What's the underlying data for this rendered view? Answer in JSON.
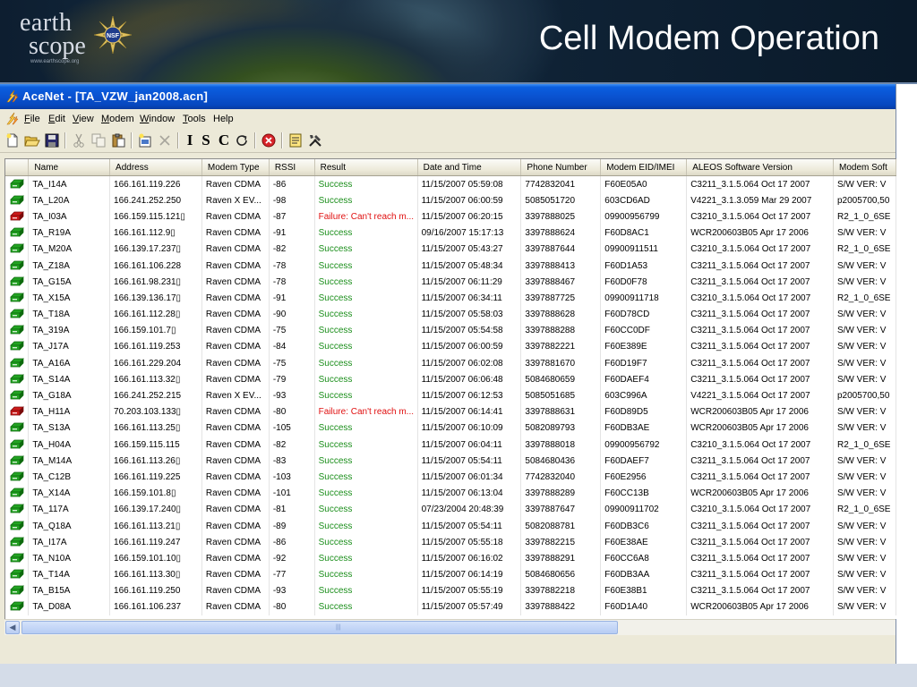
{
  "slide": {
    "title": "Cell Modem Operation",
    "logo_line1": "earth",
    "logo_line2": "scope",
    "logo_url": "www.earthscope.org",
    "nsf_label": "NSF"
  },
  "window": {
    "title": "AceNet - [TA_VZW_jan2008.acn]"
  },
  "menu": [
    {
      "label": "File",
      "key": "F",
      "rest": "ile"
    },
    {
      "label": "Edit",
      "key": "E",
      "rest": "dit"
    },
    {
      "label": "View",
      "key": "V",
      "rest": "iew"
    },
    {
      "label": "Modem",
      "key": "M",
      "rest": "odem"
    },
    {
      "label": "Window",
      "key": "W",
      "rest": "indow"
    },
    {
      "label": "Tools",
      "key": "T",
      "rest": "ools"
    },
    {
      "label": "Help",
      "key": "",
      "rest": "Help"
    }
  ],
  "toolbar": {
    "letters": [
      "I",
      "S",
      "C"
    ]
  },
  "columns": [
    "",
    "Name",
    "Address",
    "Modem Type",
    "RSSI",
    "Result",
    "Date and Time",
    "Phone Number",
    "Modem EID/IMEI",
    "ALEOS Software Version",
    "Modem Soft"
  ],
  "rows": [
    {
      "status": "ok",
      "name": "TA_I14A",
      "address": "166.161.119.226",
      "type": "Raven CDMA",
      "rssi": "-86",
      "result": "Success",
      "datetime": "11/15/2007 05:59:08",
      "phone": "7742832041",
      "eid": "F60E05A0",
      "aleos": "C3211_3.1.5.064 Oct 17 2007",
      "soft": "S/W VER: V"
    },
    {
      "status": "ok",
      "name": "TA_L20A",
      "address": "166.241.252.250",
      "type": "Raven X EV...",
      "rssi": "-98",
      "result": "Success",
      "datetime": "11/15/2007 06:00:59",
      "phone": "5085051720",
      "eid": "603CD6AD",
      "aleos": "V4221_3.1.3.059 Mar 29 2007",
      "soft": "p2005700,50"
    },
    {
      "status": "fail",
      "name": "TA_I03A",
      "address": "166.159.115.121▯",
      "type": "Raven CDMA",
      "rssi": "-87",
      "result": "Failure: Can't reach m...",
      "datetime": "11/15/2007 06:20:15",
      "phone": "3397888025",
      "eid": "09900956799",
      "aleos": "C3210_3.1.5.064 Oct 17 2007",
      "soft": "R2_1_0_6SE"
    },
    {
      "status": "ok",
      "name": "TA_R19A",
      "address": "166.161.112.9▯",
      "type": "Raven CDMA",
      "rssi": "-91",
      "result": "Success",
      "datetime": "09/16/2007 15:17:13",
      "phone": "3397888624",
      "eid": "F60D8AC1",
      "aleos": "WCR200603B05 Apr 17 2006",
      "soft": "S/W VER: V"
    },
    {
      "status": "ok",
      "name": "TA_M20A",
      "address": "166.139.17.237▯",
      "type": "Raven CDMA",
      "rssi": "-82",
      "result": "Success",
      "datetime": "11/15/2007 05:43:27",
      "phone": "3397887644",
      "eid": "09900911511",
      "aleos": "C3210_3.1.5.064 Oct 17 2007",
      "soft": "R2_1_0_6SE"
    },
    {
      "status": "ok",
      "name": "TA_Z18A",
      "address": "166.161.106.228",
      "type": "Raven CDMA",
      "rssi": "-78",
      "result": "Success",
      "datetime": "11/15/2007 05:48:34",
      "phone": "3397888413",
      "eid": "F60D1A53",
      "aleos": "C3211_3.1.5.064 Oct 17 2007",
      "soft": "S/W VER: V"
    },
    {
      "status": "ok",
      "name": "TA_G15A",
      "address": "166.161.98.231▯",
      "type": "Raven CDMA",
      "rssi": "-78",
      "result": "Success",
      "datetime": "11/15/2007 06:11:29",
      "phone": "3397888467",
      "eid": "F60D0F78",
      "aleos": "C3211_3.1.5.064 Oct 17 2007",
      "soft": "S/W VER: V"
    },
    {
      "status": "ok",
      "name": "TA_X15A",
      "address": "166.139.136.17▯",
      "type": "Raven CDMA",
      "rssi": "-91",
      "result": "Success",
      "datetime": "11/15/2007 06:34:11",
      "phone": "3397887725",
      "eid": "09900911718",
      "aleos": "C3210_3.1.5.064 Oct 17 2007",
      "soft": "R2_1_0_6SE"
    },
    {
      "status": "ok",
      "name": "TA_T18A",
      "address": "166.161.112.28▯",
      "type": "Raven CDMA",
      "rssi": "-90",
      "result": "Success",
      "datetime": "11/15/2007 05:58:03",
      "phone": "3397888628",
      "eid": "F60D78CD",
      "aleos": "C3211_3.1.5.064 Oct 17 2007",
      "soft": "S/W VER: V"
    },
    {
      "status": "ok",
      "name": "TA_319A",
      "address": "166.159.101.7▯",
      "type": "Raven CDMA",
      "rssi": "-75",
      "result": "Success",
      "datetime": "11/15/2007 05:54:58",
      "phone": "3397888288",
      "eid": "F60CC0DF",
      "aleos": "C3211_3.1.5.064 Oct 17 2007",
      "soft": "S/W VER: V"
    },
    {
      "status": "ok",
      "name": "TA_J17A",
      "address": "166.161.119.253",
      "type": "Raven CDMA",
      "rssi": "-84",
      "result": "Success",
      "datetime": "11/15/2007 06:00:59",
      "phone": "3397882221",
      "eid": "F60E389E",
      "aleos": "C3211_3.1.5.064 Oct 17 2007",
      "soft": "S/W VER: V"
    },
    {
      "status": "ok",
      "name": "TA_A16A",
      "address": "166.161.229.204",
      "type": "Raven CDMA",
      "rssi": "-75",
      "result": "Success",
      "datetime": "11/15/2007 06:02:08",
      "phone": "3397881670",
      "eid": "F60D19F7",
      "aleos": "C3211_3.1.5.064 Oct 17 2007",
      "soft": "S/W VER: V"
    },
    {
      "status": "ok",
      "name": "TA_S14A",
      "address": "166.161.113.32▯",
      "type": "Raven CDMA",
      "rssi": "-79",
      "result": "Success",
      "datetime": "11/15/2007 06:06:48",
      "phone": "5084680659",
      "eid": "F60DAEF4",
      "aleos": "C3211_3.1.5.064 Oct 17 2007",
      "soft": "S/W VER: V"
    },
    {
      "status": "ok",
      "name": "TA_G18A",
      "address": "166.241.252.215",
      "type": "Raven X EV...",
      "rssi": "-93",
      "result": "Success",
      "datetime": "11/15/2007 06:12:53",
      "phone": "5085051685",
      "eid": "603C996A",
      "aleos": "V4221_3.1.5.064 Oct 17 2007",
      "soft": "p2005700,50"
    },
    {
      "status": "fail",
      "name": "TA_H11A",
      "address": "70.203.103.133▯",
      "type": "Raven CDMA",
      "rssi": "-80",
      "result": "Failure: Can't reach m...",
      "datetime": "11/15/2007 06:14:41",
      "phone": "3397888631",
      "eid": "F60D89D5",
      "aleos": "WCR200603B05 Apr 17 2006",
      "soft": "S/W VER: V"
    },
    {
      "status": "ok",
      "name": "TA_S13A",
      "address": "166.161.113.25▯",
      "type": "Raven CDMA",
      "rssi": "-105",
      "result": "Success",
      "datetime": "11/15/2007 06:10:09",
      "phone": "5082089793",
      "eid": "F60DB3AE",
      "aleos": "WCR200603B05 Apr 17 2006",
      "soft": "S/W VER: V"
    },
    {
      "status": "ok",
      "name": "TA_H04A",
      "address": "166.159.115.115",
      "type": "Raven CDMA",
      "rssi": "-82",
      "result": "Success",
      "datetime": "11/15/2007 06:04:11",
      "phone": "3397888018",
      "eid": "09900956792",
      "aleos": "C3210_3.1.5.064 Oct 17 2007",
      "soft": "R2_1_0_6SE"
    },
    {
      "status": "ok",
      "name": "TA_M14A",
      "address": "166.161.113.26▯",
      "type": "Raven CDMA",
      "rssi": "-83",
      "result": "Success",
      "datetime": "11/15/2007 05:54:11",
      "phone": "5084680436",
      "eid": "F60DAEF7",
      "aleos": "C3211_3.1.5.064 Oct 17 2007",
      "soft": "S/W VER: V"
    },
    {
      "status": "ok",
      "name": "TA_C12B",
      "address": "166.161.119.225",
      "type": "Raven CDMA",
      "rssi": "-103",
      "result": "Success",
      "datetime": "11/15/2007 06:01:34",
      "phone": "7742832040",
      "eid": "F60E2956",
      "aleos": "C3211_3.1.5.064 Oct 17 2007",
      "soft": "S/W VER: V"
    },
    {
      "status": "ok",
      "name": "TA_X14A",
      "address": "166.159.101.8▯",
      "type": "Raven CDMA",
      "rssi": "-101",
      "result": "Success",
      "datetime": "11/15/2007 06:13:04",
      "phone": "3397888289",
      "eid": "F60CC13B",
      "aleos": "WCR200603B05 Apr 17 2006",
      "soft": "S/W VER: V"
    },
    {
      "status": "ok",
      "name": "TA_117A",
      "address": "166.139.17.240▯",
      "type": "Raven CDMA",
      "rssi": "-81",
      "result": "Success",
      "datetime": "07/23/2004 20:48:39",
      "phone": "3397887647",
      "eid": "09900911702",
      "aleos": "C3210_3.1.5.064 Oct 17 2007",
      "soft": "R2_1_0_6SE"
    },
    {
      "status": "ok",
      "name": "TA_Q18A",
      "address": "166.161.113.21▯",
      "type": "Raven CDMA",
      "rssi": "-89",
      "result": "Success",
      "datetime": "11/15/2007 05:54:11",
      "phone": "5082088781",
      "eid": "F60DB3C6",
      "aleos": "C3211_3.1.5.064 Oct 17 2007",
      "soft": "S/W VER: V"
    },
    {
      "status": "ok",
      "name": "TA_I17A",
      "address": "166.161.119.247",
      "type": "Raven CDMA",
      "rssi": "-86",
      "result": "Success",
      "datetime": "11/15/2007 05:55:18",
      "phone": "3397882215",
      "eid": "F60E38AE",
      "aleos": "C3211_3.1.5.064 Oct 17 2007",
      "soft": "S/W VER: V"
    },
    {
      "status": "ok",
      "name": "TA_N10A",
      "address": "166.159.101.10▯",
      "type": "Raven CDMA",
      "rssi": "-92",
      "result": "Success",
      "datetime": "11/15/2007 06:16:02",
      "phone": "3397888291",
      "eid": "F60CC6A8",
      "aleos": "C3211_3.1.5.064 Oct 17 2007",
      "soft": "S/W VER: V"
    },
    {
      "status": "ok",
      "name": "TA_T14A",
      "address": "166.161.113.30▯",
      "type": "Raven CDMA",
      "rssi": "-77",
      "result": "Success",
      "datetime": "11/15/2007 06:14:19",
      "phone": "5084680656",
      "eid": "F60DB3AA",
      "aleos": "C3211_3.1.5.064 Oct 17 2007",
      "soft": "S/W VER: V"
    },
    {
      "status": "ok",
      "name": "TA_B15A",
      "address": "166.161.119.250",
      "type": "Raven CDMA",
      "rssi": "-93",
      "result": "Success",
      "datetime": "11/15/2007 05:55:19",
      "phone": "3397882218",
      "eid": "F60E38B1",
      "aleos": "C3211_3.1.5.064 Oct 17 2007",
      "soft": "S/W VER: V"
    },
    {
      "status": "ok",
      "name": "TA_D08A",
      "address": "166.161.106.237",
      "type": "Raven CDMA",
      "rssi": "-80",
      "result": "Success",
      "datetime": "11/15/2007 05:57:49",
      "phone": "3397888422",
      "eid": "F60D1A40",
      "aleos": "WCR200603B05 Apr 17 2006",
      "soft": "S/W VER: V"
    }
  ],
  "colors": {
    "success": "#1c8f1c",
    "failure": "#e01010",
    "titlebar": "#0a52d0",
    "modem_ok": "#22a322",
    "modem_fail": "#cc1a1a"
  }
}
